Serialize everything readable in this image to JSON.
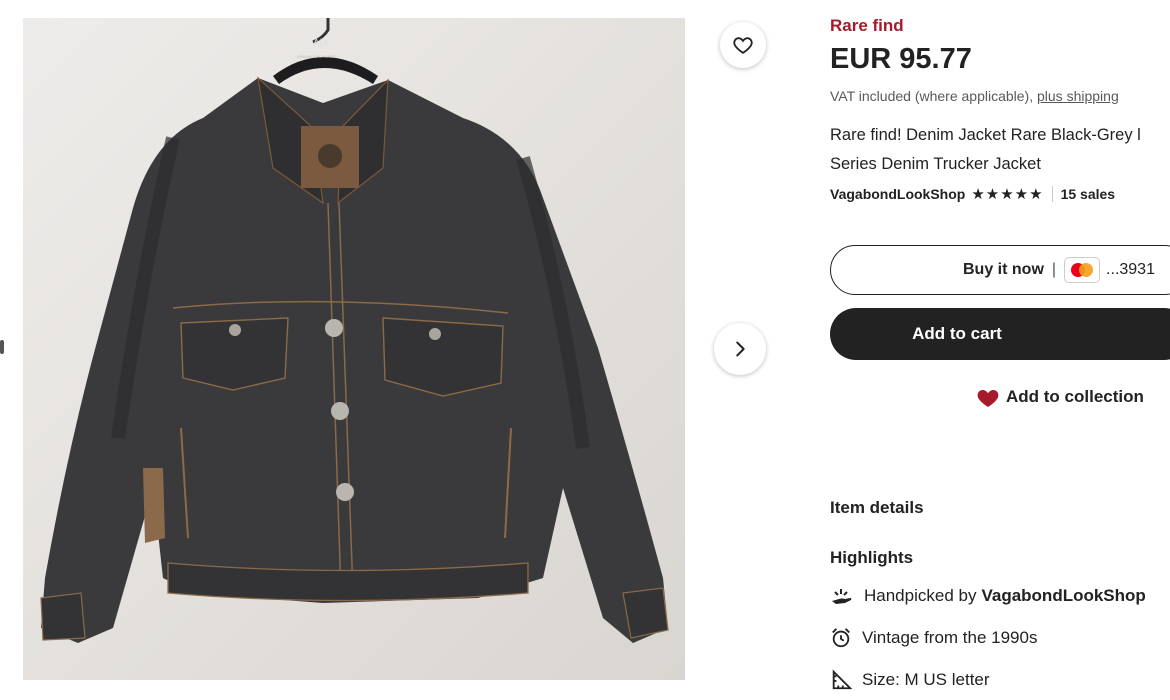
{
  "product": {
    "badge": "Rare find",
    "price": "EUR 95.77",
    "vat_text": "VAT included (where applicable), ",
    "shipping_link": "plus shipping",
    "title_line1": "Rare find! Denim Jacket Rare Black-Grey l",
    "title_line2": "Series Denim Trucker Jacket"
  },
  "seller": {
    "name": "VagabondLookShop",
    "stars": "★★★★★",
    "sales": "15 sales"
  },
  "actions": {
    "buy_now": "Buy it now",
    "pipe": "|",
    "card_suffix": "...3931",
    "add_to_cart": "Add to cart",
    "add_to_collection": "Add to collection"
  },
  "sections": {
    "item_details": "Item details",
    "highlights": "Highlights"
  },
  "highlights": {
    "handpicked_prefix": "Handpicked by",
    "handpicked_shop": "VagabondLookShop",
    "vintage": "Vintage from the 1990s",
    "size": "Size: M US letter"
  },
  "image": {
    "hanger_logo": "A|X",
    "hanger_subtext": "ARMANI EXCHANGE"
  },
  "colors": {
    "accent_red": "#a61a2e",
    "button_dark": "#222222"
  },
  "icons": {
    "favorite": "heart-outline-icon",
    "next": "chevron-right-icon",
    "collection": "heart-filled-icon",
    "handpicked": "hand-sparkle-icon",
    "vintage": "alarm-clock-icon",
    "size": "ruler-triangle-icon",
    "card": "mastercard-icon"
  }
}
